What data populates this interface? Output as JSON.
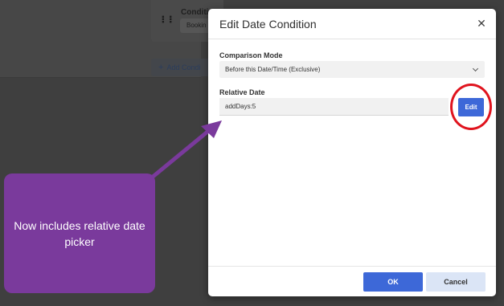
{
  "background": {
    "condition_label": "Conditi",
    "condition_field_value": "Bookin",
    "add_condition_label": "Add Condi",
    "add_icon": "plus-icon",
    "grip_icon": "drag-handle-icon"
  },
  "modal": {
    "title": "Edit Date Condition",
    "close_icon": "close-icon",
    "comparison_mode": {
      "label": "Comparison Mode",
      "selected": "Before this Date/Time (Exclusive)"
    },
    "relative_date": {
      "label": "Relative Date",
      "value": "addDays:5",
      "edit_label": "Edit"
    },
    "footer": {
      "ok_label": "OK",
      "cancel_label": "Cancel"
    }
  },
  "annotation": {
    "callout_text": "Now includes relative date picker",
    "callout_color": "#7a3a9c",
    "circle_color": "#e0141e"
  },
  "colors": {
    "primary": "#3d68d8",
    "secondary": "#dbe5f6"
  }
}
